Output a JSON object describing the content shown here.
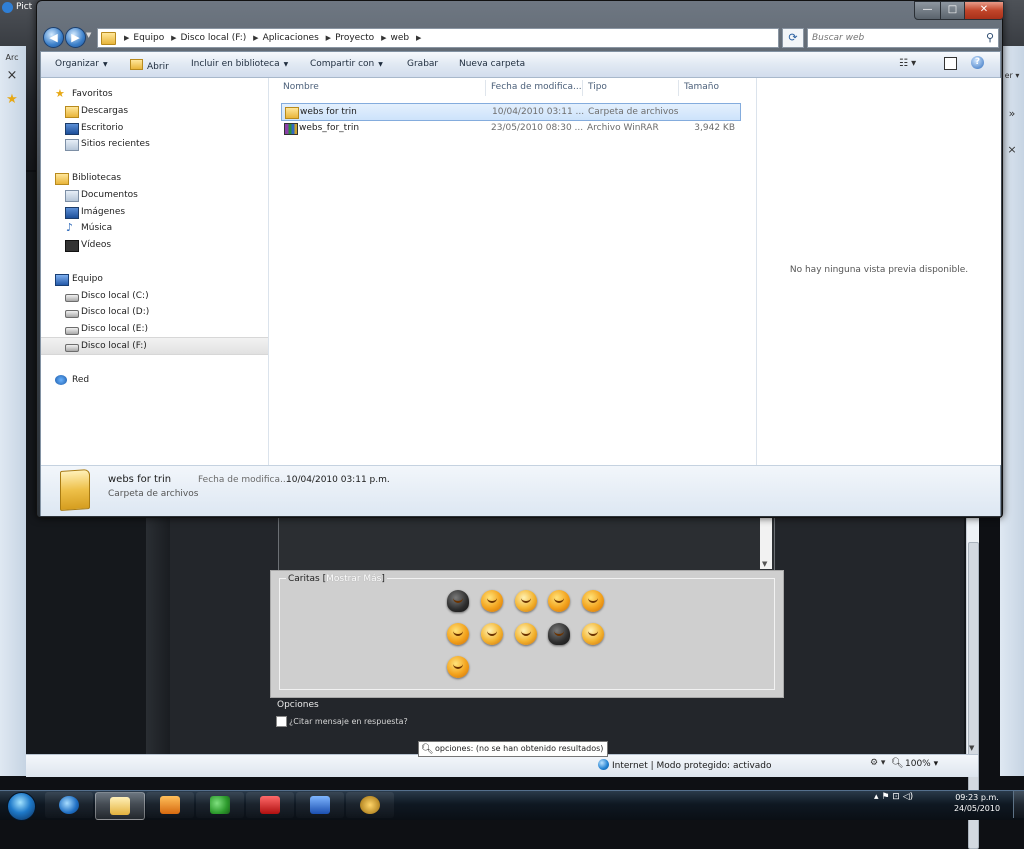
{
  "background_window": {
    "title_fragment": "Pict",
    "side_glyphs": [
      "Arc",
      "×",
      "★"
    ],
    "right_glyphs": [
      "er ▾",
      "»",
      "×"
    ],
    "caritas_label": "Caritas [",
    "caritas_more": "Mostrar Más",
    "caritas_close": "]",
    "opciones_label": "Opciones",
    "citar_label": "¿Citar mensaje en respuesta?",
    "tooltip": "opciones: (no se han obtenido resultados)",
    "zone_text": "Internet | Modo protegido: activado",
    "zoom_text": "100%",
    "zoom_dropdown": "▾"
  },
  "explorer": {
    "window_buttons": {
      "minimize": "—",
      "maximize": "□",
      "close": "✕"
    },
    "breadcrumbs": [
      "Equipo",
      "Disco local (F:)",
      "Aplicaciones",
      "Proyecto",
      "web"
    ],
    "search_placeholder": "Buscar web",
    "toolbar": {
      "organize": "Organizar",
      "open": "Abrir",
      "include": "Incluir en biblioteca",
      "share": "Compartir con",
      "burn": "Grabar",
      "new_folder": "Nueva carpeta",
      "help": "?"
    },
    "nav": {
      "favorites": "Favoritos",
      "downloads": "Descargas",
      "desktop": "Escritorio",
      "recent": "Sitios recientes",
      "libraries": "Bibliotecas",
      "documents": "Documentos",
      "images": "Imágenes",
      "music": "Música",
      "videos": "Vídeos",
      "computer": "Equipo",
      "drive_c": "Disco local (C:)",
      "drive_d": "Disco local (D:)",
      "drive_e": "Disco local (E:)",
      "drive_f": "Disco local (F:)",
      "network": "Red"
    },
    "columns": [
      "Nombre",
      "Fecha de modifica...",
      "Tipo",
      "Tamaño"
    ],
    "files": [
      {
        "name": "webs for trin",
        "date": "10/04/2010 03:11 ...",
        "type": "Carpeta de archivos",
        "size": ""
      },
      {
        "name": "webs_for_trin",
        "date": "23/05/2010 08:30 ...",
        "type": "Archivo WinRAR",
        "size": "3,942 KB"
      }
    ],
    "preview_text": "No hay ninguna vista previa disponible.",
    "details": {
      "name": "webs for trin",
      "type": "Carpeta de archivos",
      "date_label": "Fecha de modifica...",
      "date_value": "10/04/2010 03:11 p.m."
    }
  },
  "taskbar": {
    "clock_time": "09:23 p.m.",
    "clock_date": "24/05/2010",
    "active_index": 1
  }
}
